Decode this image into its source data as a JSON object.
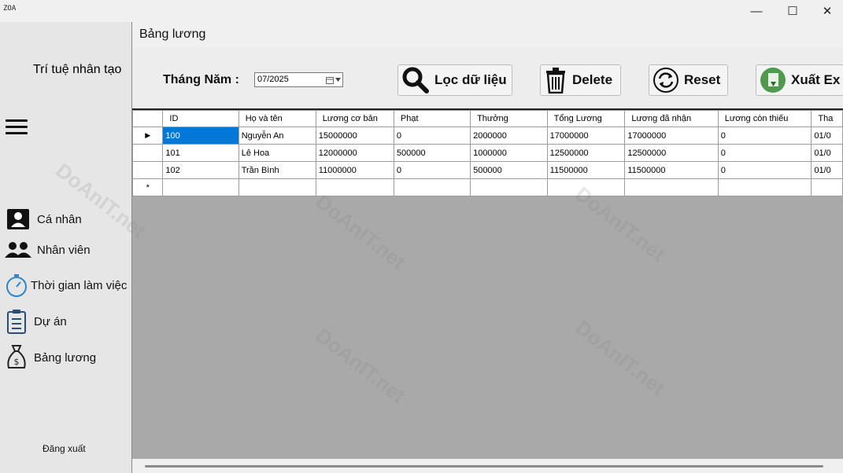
{
  "window": {
    "app_icon_text": "ZOA",
    "minimize": "—",
    "maximize": "☐",
    "close": "✕"
  },
  "sidebar": {
    "brand": "Trí tuệ nhân tạo",
    "items": [
      {
        "label": "Cá nhân",
        "icon": "person-badge-icon"
      },
      {
        "label": "Nhân viên",
        "icon": "people-icon"
      },
      {
        "label": "Thời gian làm việc",
        "icon": "stopwatch-icon"
      },
      {
        "label": "Dự án",
        "icon": "clipboard-list-icon"
      },
      {
        "label": "Bảng lương",
        "icon": "money-bag-icon"
      }
    ],
    "logout": "Đăng xuất"
  },
  "form_title": "Bảng lương",
  "filter": {
    "label": "Tháng Năm :",
    "value": "07/2025"
  },
  "toolbar": {
    "filter_label": "Lọc dữ liệu",
    "delete_label": "Delete",
    "reset_label": "Reset",
    "export_label": "Xuất Ex"
  },
  "grid": {
    "columns": [
      "ID",
      "Họ và tên",
      "Lương cơ bản",
      "Phạt",
      "Thưởng",
      "Tổng Lương",
      "Lương đã nhận",
      "Lương còn thiếu",
      "Tha"
    ],
    "rows": [
      [
        "100",
        "Nguyễn An",
        "15000000",
        "0",
        "2000000",
        "17000000",
        "17000000",
        "0",
        "01/0"
      ],
      [
        "101",
        "Lê Hoa",
        "12000000",
        "500000",
        "1000000",
        "12500000",
        "12500000",
        "0",
        "01/0"
      ],
      [
        "102",
        "Trần Bình",
        "11000000",
        "0",
        "500000",
        "11500000",
        "11500000",
        "0",
        "01/0"
      ]
    ],
    "current_row_marker": "▶",
    "new_row_marker": "*"
  },
  "watermark": "DoAnIT.net",
  "colors": {
    "selection": "#0078d7",
    "grid_background": "#a9a9a9",
    "sidebar": "#e6e6e6"
  }
}
